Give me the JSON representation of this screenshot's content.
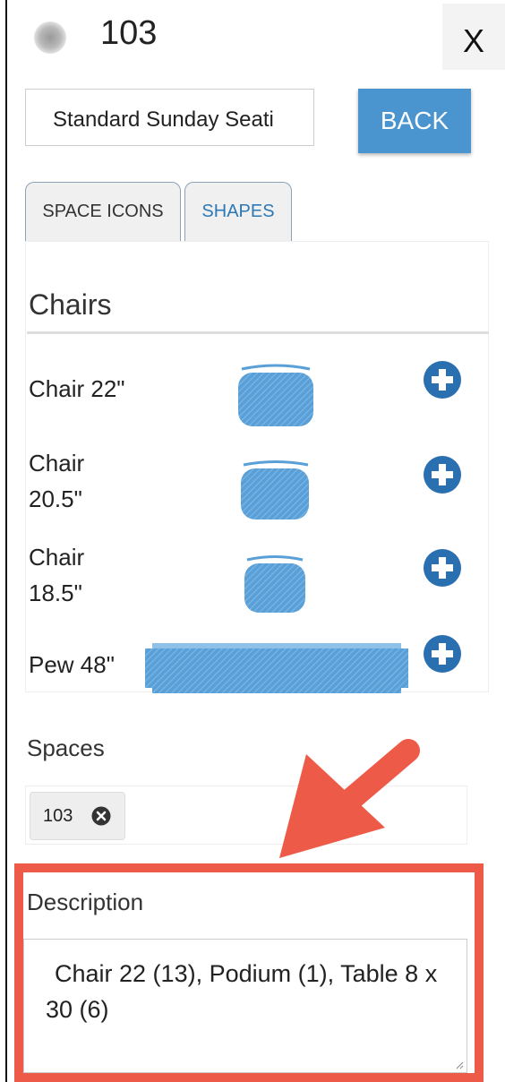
{
  "header": {
    "title": "103",
    "close_label": "X"
  },
  "toolbar": {
    "layout_value": "Standard Sunday Seati",
    "back_label": "BACK"
  },
  "tabs": [
    {
      "label": "SPACE ICONS",
      "active": true
    },
    {
      "label": "SHAPES",
      "active": false
    }
  ],
  "panel": {
    "title": "Chairs",
    "items": [
      {
        "label": "Chair 22\"",
        "shape": "chair"
      },
      {
        "label": "Chair 20.5\"",
        "shape": "chair"
      },
      {
        "label": "Chair 18.5\"",
        "shape": "chair"
      },
      {
        "label": "Pew 48\"",
        "shape": "pew"
      }
    ],
    "add_icon": "plus-circle-icon"
  },
  "spaces": {
    "label": "Spaces",
    "tags": [
      "103"
    ],
    "remove_icon": "close-circle-icon"
  },
  "description": {
    "label": "Description",
    "value": "Chair 22 (13), Podium (1), Table 8 x 30 (6)"
  },
  "colors": {
    "accent": "#4a94cf",
    "tab_active_text": "#2e78b5",
    "icon_blue": "#2a6fb0",
    "shape_fill": "#5aa0d8",
    "highlight": "#ee5a48"
  }
}
